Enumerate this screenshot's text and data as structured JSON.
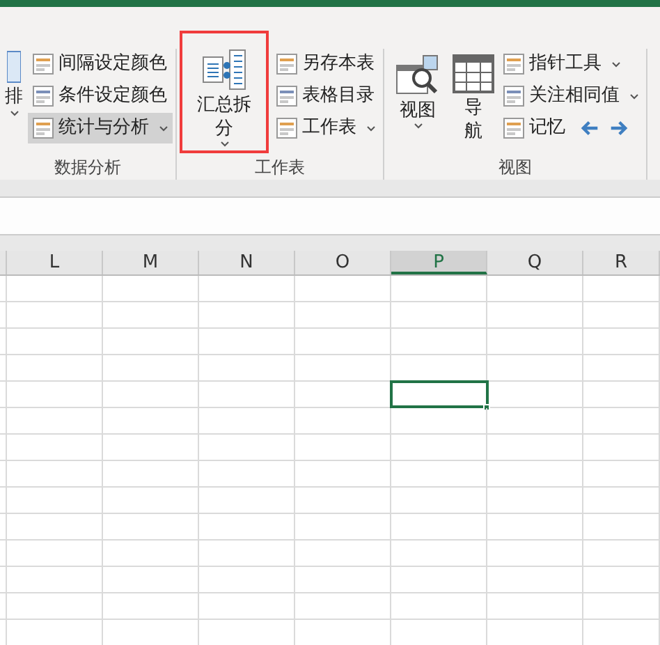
{
  "ribbon": {
    "groups": [
      {
        "label": "数据分析",
        "partial_button": {
          "label": "排",
          "has_dropdown": true
        },
        "small_buttons": [
          {
            "label": "间隔设定颜色",
            "selected": false,
            "has_dropdown": false
          },
          {
            "label": "条件设定颜色",
            "selected": false,
            "has_dropdown": false
          },
          {
            "label": "统计与分析",
            "selected": true,
            "has_dropdown": true
          }
        ]
      },
      {
        "label": "工作表",
        "big_buttons": [
          {
            "kind": "merge",
            "label": "汇总拆分",
            "has_dropdown": true,
            "highlighted": true
          }
        ],
        "small_buttons": [
          {
            "label": "另存本表",
            "selected": false,
            "has_dropdown": false
          },
          {
            "label": "表格目录",
            "selected": false,
            "has_dropdown": false
          },
          {
            "label": "工作表",
            "selected": false,
            "has_dropdown": true
          }
        ]
      },
      {
        "label": "视图",
        "big_buttons": [
          {
            "kind": "view",
            "label": "视图",
            "has_dropdown": true,
            "highlighted": false
          },
          {
            "kind": "nav",
            "label": "导航",
            "has_dropdown": false,
            "highlighted": false
          }
        ],
        "small_buttons": [
          {
            "label": "指针工具",
            "selected": false,
            "has_dropdown": true
          },
          {
            "label": "关注相同值",
            "selected": false,
            "has_dropdown": true
          },
          {
            "label": "记忆",
            "selected": false,
            "has_dropdown": false,
            "arrows": true
          }
        ]
      }
    ]
  },
  "sheet": {
    "columns": [
      {
        "label": "L",
        "selected": false
      },
      {
        "label": "M",
        "selected": false
      },
      {
        "label": "N",
        "selected": false
      },
      {
        "label": "O",
        "selected": false
      },
      {
        "label": "P",
        "selected": true
      },
      {
        "label": "Q",
        "selected": false
      },
      {
        "label": "R",
        "selected": false
      }
    ],
    "rows": [
      {
        "selected": false
      },
      {
        "selected": false
      },
      {
        "selected": false
      },
      {
        "selected": false
      },
      {
        "selected": true
      },
      {
        "selected": false
      },
      {
        "selected": false
      },
      {
        "selected": false
      },
      {
        "selected": false
      },
      {
        "selected": false
      },
      {
        "selected": false
      },
      {
        "selected": false
      },
      {
        "selected": false
      },
      {
        "selected": false
      }
    ]
  }
}
